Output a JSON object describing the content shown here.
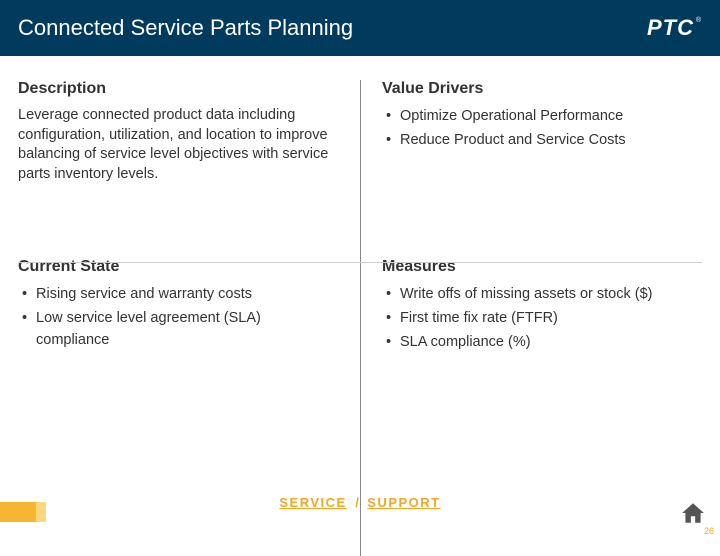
{
  "header": {
    "title": "Connected Service Parts Planning",
    "logo": "PTC"
  },
  "quad": {
    "tl": {
      "heading": "Description",
      "body": "Leverage connected product data including configuration, utilization, and location to improve balancing of service level objectives with service parts inventory levels."
    },
    "tr": {
      "heading": "Value Drivers",
      "items": [
        "Optimize Operational Performance",
        "Reduce Product and Service Costs"
      ]
    },
    "bl": {
      "heading": "Current State",
      "items": [
        "Rising service and warranty costs",
        "Low service level agreement (SLA) compliance"
      ]
    },
    "br": {
      "heading": "Measures",
      "items": [
        "Write offs of missing assets or stock ($)",
        "First time fix rate (FTFR)",
        "SLA compliance (%)"
      ]
    }
  },
  "footer": {
    "link1": "SERVICE",
    "sep": "/",
    "link2": "SUPPORT"
  },
  "page_number": "26"
}
